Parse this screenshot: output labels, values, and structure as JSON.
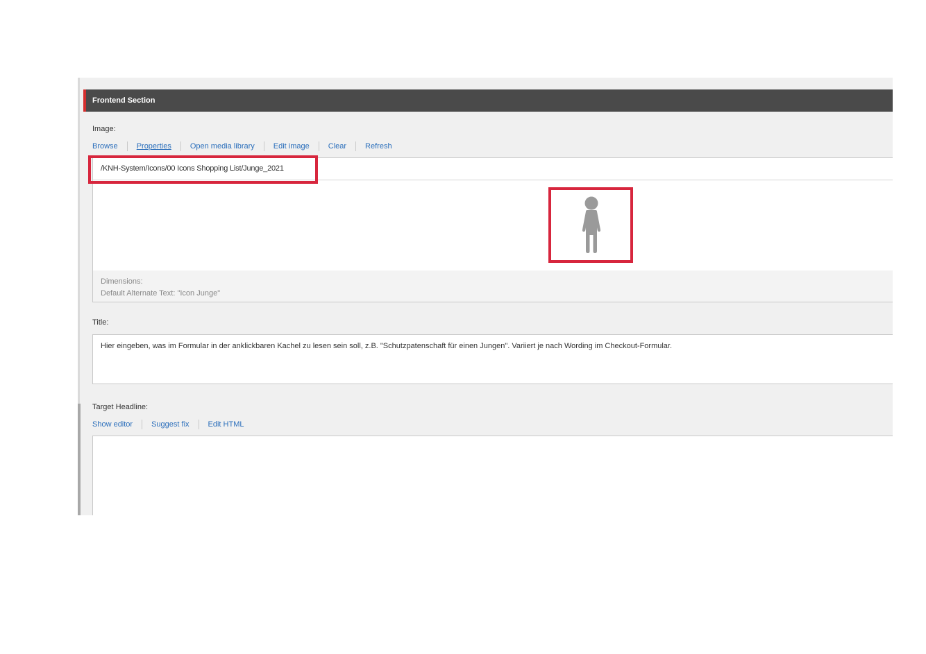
{
  "section": {
    "title": "Frontend Section"
  },
  "image_field": {
    "label": "Image:",
    "actions": [
      {
        "label": "Browse"
      },
      {
        "label": "Properties"
      },
      {
        "label": "Open media library"
      },
      {
        "label": "Edit image"
      },
      {
        "label": "Clear"
      },
      {
        "label": "Refresh"
      }
    ],
    "path": "/KNH-System/Icons/00 Icons Shopping List/Junge_2021",
    "preview_icon": "person-child-icon",
    "dimensions_label": "Dimensions:",
    "alt_text_label": "Default Alternate Text: \"Icon Junge\""
  },
  "title_field": {
    "label": "Title:",
    "value": "Hier eingeben, was im Formular in der anklickbaren Kachel zu lesen sein soll, z.B. \"Schutzpatenschaft für einen Jungen\". Variiert je nach Wording im Checkout-Formular."
  },
  "target_headline_field": {
    "label": "Target Headline:",
    "actions": [
      {
        "label": "Show editor"
      },
      {
        "label": "Suggest fix"
      },
      {
        "label": "Edit HTML"
      }
    ],
    "value": ""
  },
  "colors": {
    "header_bg": "#4a4a4a",
    "header_accent": "#d32f2f",
    "link": "#2a6ebb",
    "highlight": "#d7263d",
    "icon": "#9a9a9a"
  }
}
